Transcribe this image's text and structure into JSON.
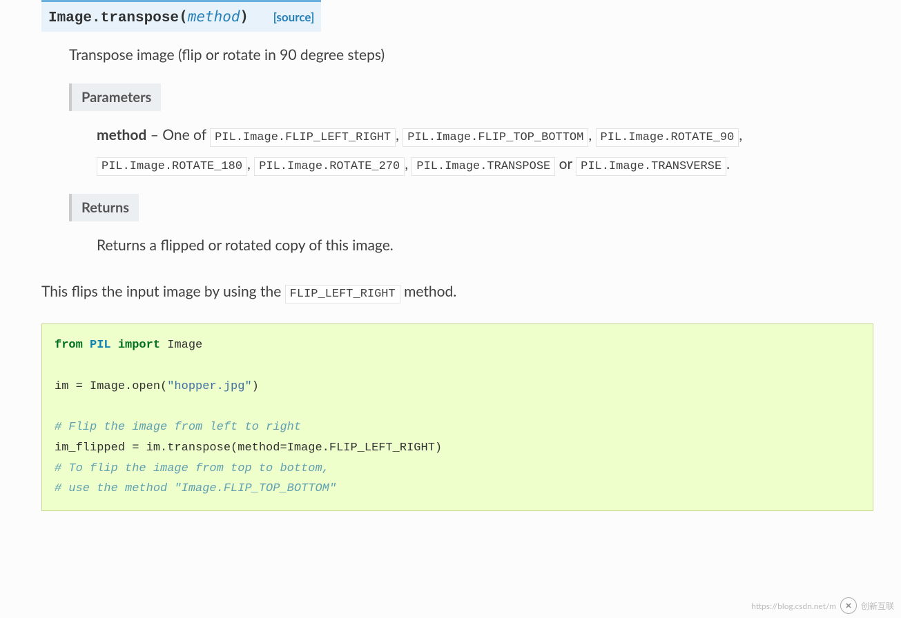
{
  "signature": {
    "classname": "Image.transpose",
    "param": "method",
    "source_label": "[source]"
  },
  "description": "Transpose image (flip or rotate in 90 degree steps)",
  "fields": {
    "parameters": {
      "label": "Parameters",
      "param_name": "method",
      "dash": " – One of ",
      "options": [
        "PIL.Image.FLIP_LEFT_RIGHT",
        "PIL.Image.FLIP_TOP_BOTTOM",
        "PIL.Image.ROTATE_90",
        "PIL.Image.ROTATE_180",
        "PIL.Image.ROTATE_270",
        "PIL.Image.TRANSPOSE",
        "PIL.Image.TRANSVERSE"
      ],
      "sep_comma": ", ",
      "sep_or": " or ",
      "sep_period": "."
    },
    "returns": {
      "label": "Returns",
      "text": "Returns a flipped or rotated copy of this image."
    }
  },
  "body_text": {
    "pre": "This flips the input image by using the ",
    "code": "FLIP_LEFT_RIGHT",
    "post": " method."
  },
  "code": {
    "kw_from": "from",
    "mod": "PIL",
    "kw_import": "import",
    "cls": "Image",
    "line2": "im = Image.open(",
    "str1": "\"hopper.jpg\"",
    "line2_close": ")",
    "cmt1": "# Flip the image from left to right",
    "line4": "im_flipped = im.transpose(method=Image.FLIP_LEFT_RIGHT)",
    "cmt2": "# To flip the image from top to bottom,",
    "cmt3": "# use the method \"Image.FLIP_TOP_BOTTOM\""
  },
  "watermark": {
    "url": "https://blog.csdn.net/m",
    "brand": "创新互联"
  }
}
